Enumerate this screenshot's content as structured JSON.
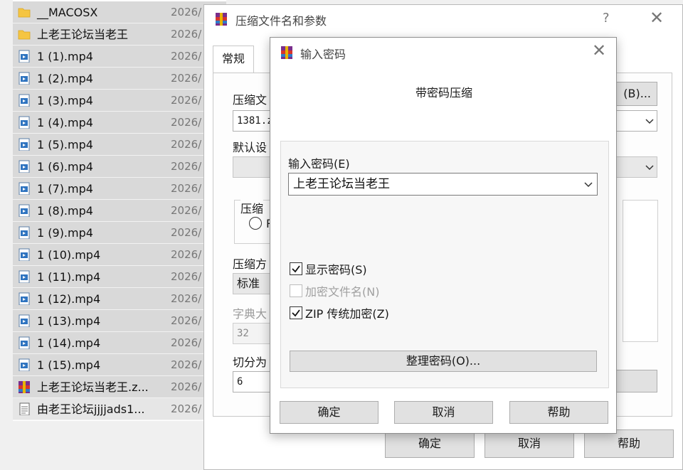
{
  "file_list": {
    "files": [
      {
        "name": "__MACOSX",
        "date": "2026/",
        "icon": "folder-icon"
      },
      {
        "name": "上老王论坛当老王",
        "date": "2026/",
        "icon": "folder-icon"
      },
      {
        "name": "1 (1).mp4",
        "date": "2026/",
        "icon": "video-file-icon"
      },
      {
        "name": "1 (2).mp4",
        "date": "2026/",
        "icon": "video-file-icon"
      },
      {
        "name": "1 (3).mp4",
        "date": "2026/",
        "icon": "video-file-icon"
      },
      {
        "name": "1 (4).mp4",
        "date": "2026/",
        "icon": "video-file-icon"
      },
      {
        "name": "1 (5).mp4",
        "date": "2026/",
        "icon": "video-file-icon"
      },
      {
        "name": "1 (6).mp4",
        "date": "2026/",
        "icon": "video-file-icon"
      },
      {
        "name": "1 (7).mp4",
        "date": "2026/",
        "icon": "video-file-icon"
      },
      {
        "name": "1 (8).mp4",
        "date": "2026/",
        "icon": "video-file-icon"
      },
      {
        "name": "1 (9).mp4",
        "date": "2026/",
        "icon": "video-file-icon"
      },
      {
        "name": "1 (10).mp4",
        "date": "2026/",
        "icon": "video-file-icon"
      },
      {
        "name": "1 (11).mp4",
        "date": "2026/",
        "icon": "video-file-icon"
      },
      {
        "name": "1 (12).mp4",
        "date": "2026/",
        "icon": "video-file-icon"
      },
      {
        "name": "1 (13).mp4",
        "date": "2026/",
        "icon": "video-file-icon"
      },
      {
        "name": "1 (14).mp4",
        "date": "2026/",
        "icon": "video-file-icon"
      },
      {
        "name": "1 (15).mp4",
        "date": "2026/",
        "icon": "video-file-icon"
      },
      {
        "name": "上老王论坛当老王.z...",
        "date": "2026/",
        "icon": "winrar-archive-icon"
      },
      {
        "name": "由老王论坛jjjjads1...",
        "date": "2026/",
        "icon": "text-file-icon"
      }
    ]
  },
  "archive_dialog": {
    "title": "压缩文件名和参数",
    "help_glyph": "?",
    "close_glyph": "✕",
    "tab_general": "常规",
    "archive_name_label": "压缩文",
    "archive_name_value": "1381.z",
    "browse_button": "(B)...",
    "default_profile_label": "默认设",
    "format_group_label": "压缩",
    "format_radio_partial": "R",
    "method_label": "压缩方",
    "method_value": "标准",
    "dictionary_label": "字典大",
    "dictionary_value": "32",
    "split_label": "切分为",
    "split_value": "6",
    "ok_button": "确定",
    "cancel_button": "取消",
    "help_button": "帮助"
  },
  "password_dialog": {
    "title": "输入密码",
    "close_glyph": "✕",
    "heading": "带密码压缩",
    "password_label": "输入密码(E)",
    "password_value": "上老王论坛当老王",
    "show_password": {
      "label": "显示密码(S)",
      "checked": true,
      "enabled": true
    },
    "encrypt_filenames": {
      "label": "加密文件名(N)",
      "checked": false,
      "enabled": false
    },
    "zip_legacy": {
      "label": "ZIP 传统加密(Z)",
      "checked": true,
      "enabled": true
    },
    "organize_button": "整理密码(O)...",
    "ok_button": "确定",
    "cancel_button": "取消",
    "help_button": "帮助"
  }
}
